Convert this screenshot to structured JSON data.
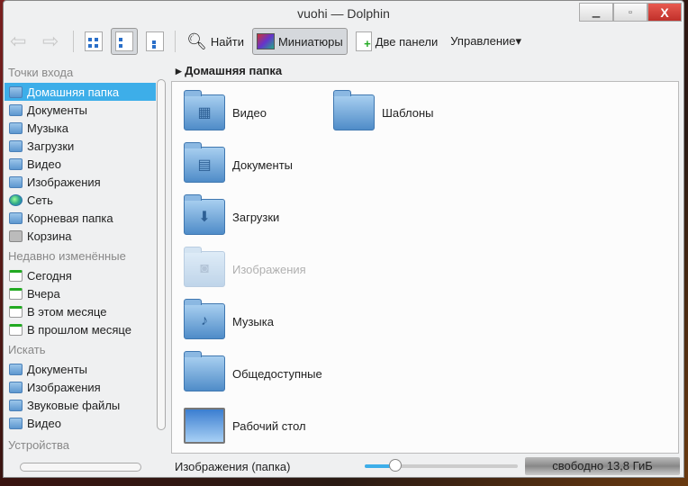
{
  "window": {
    "title": "vuohi — Dolphin"
  },
  "toolbar": {
    "find": "Найти",
    "previews": "Миниатюры",
    "split": "Две панели",
    "control": "Управление▾"
  },
  "sidebar": {
    "places_header": "Точки входа",
    "places": [
      "Домашняя папка",
      "Документы",
      "Музыка",
      "Загрузки",
      "Видео",
      "Изображения",
      "Сеть",
      "Корневая папка",
      "Корзина"
    ],
    "recent_header": "Недавно изменённые",
    "recent": [
      "Сегодня",
      "Вчера",
      "В этом месяце",
      "В прошлом месяце"
    ],
    "search_header": "Искать",
    "search": [
      "Документы",
      "Изображения",
      "Звуковые файлы",
      "Видео"
    ],
    "devices_header": "Устройства"
  },
  "breadcrumb": "Домашняя папка",
  "files": [
    "Видео",
    "Шаблоны",
    "Документы",
    "Загрузки",
    "Изображения",
    "Музыка",
    "Общедоступные",
    "Рабочий стол"
  ],
  "status": {
    "text": "Изображения (папка)",
    "free": "свободно 13,8 ГиБ",
    "zoom_fraction": 0.2
  }
}
